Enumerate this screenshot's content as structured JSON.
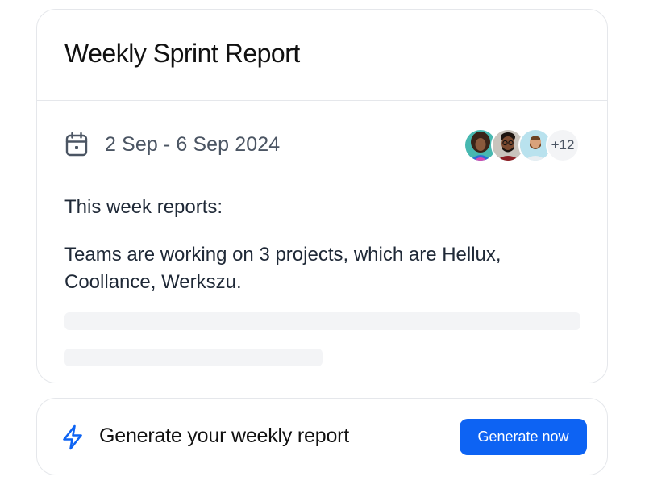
{
  "report": {
    "title": "Weekly Sprint Report",
    "date_range": "2 Sep - 6 Sep 2024",
    "calendar_icon": "calendar-icon",
    "participants": {
      "avatars": [
        "avatar-woman-curly-hair",
        "avatar-man-glasses",
        "avatar-man-beard"
      ],
      "more_count": "+12"
    },
    "intro": "This week reports:",
    "summary_line_1": "Teams are working on 3 projects, which are Hellux,",
    "summary_line_2": "Coollance, Werkszu."
  },
  "cta": {
    "icon": "lightning-bolt-icon",
    "text": "Generate your weekly report",
    "button_label": "Generate now"
  },
  "colors": {
    "accent": "#0d63f3",
    "border": "#e5e7eb",
    "skeleton": "#f3f4f6",
    "muted_text": "#4b5563"
  }
}
